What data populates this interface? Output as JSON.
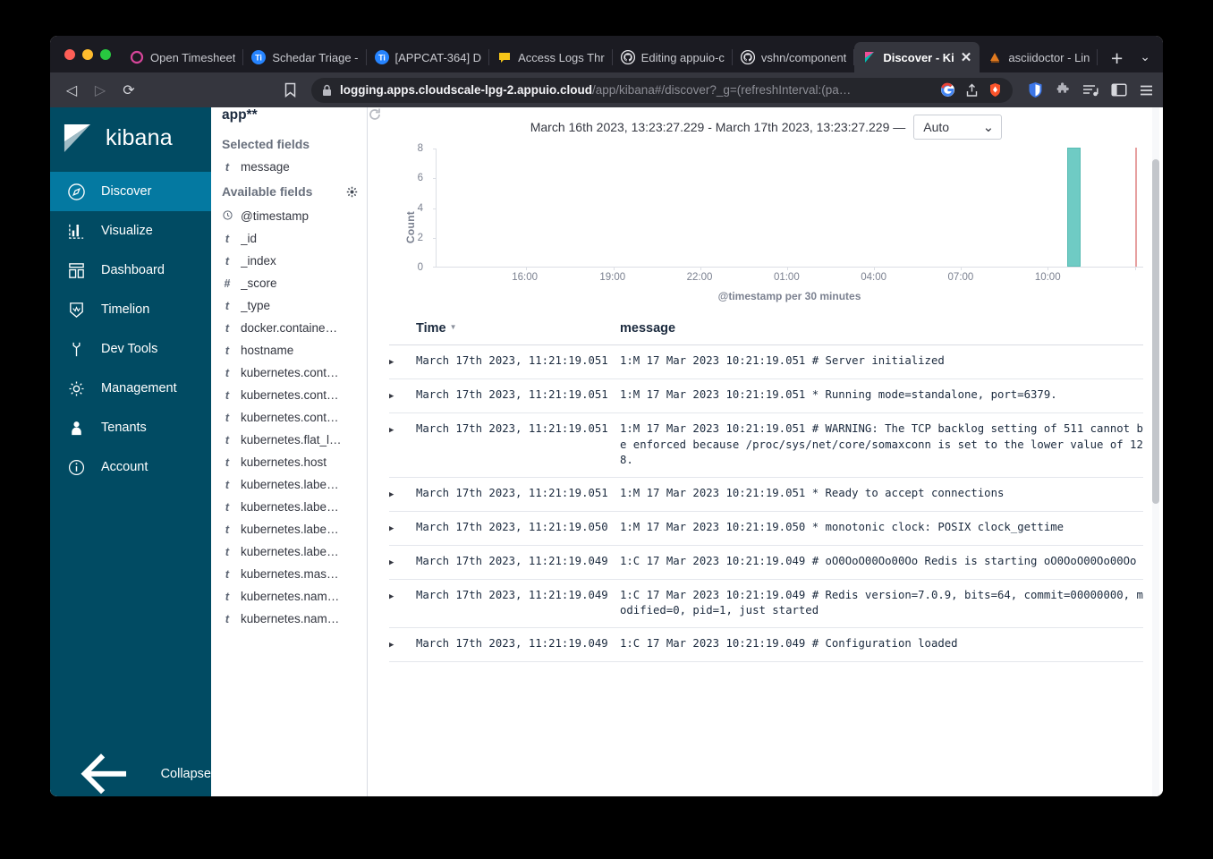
{
  "browser": {
    "tabs": [
      {
        "title": "Open Timesheet",
        "icon": "circle-pink-icon",
        "active": false
      },
      {
        "title": "Schedar Triage -",
        "icon": "jira-icon",
        "active": false
      },
      {
        "title": "[APPCAT-364] D",
        "icon": "jira-icon",
        "active": false
      },
      {
        "title": "Access Logs Thr",
        "icon": "comment-yellow-icon",
        "active": false
      },
      {
        "title": "Editing appuio-c",
        "icon": "github-icon",
        "active": false
      },
      {
        "title": "vshn/component",
        "icon": "github-icon",
        "active": false
      },
      {
        "title": "Discover - Ki",
        "icon": "kibana-icon",
        "active": true
      },
      {
        "title": "asciidoctor - Lin",
        "icon": "asciidoctor-icon",
        "active": false
      }
    ],
    "new_tab_label": "+",
    "tab_list_label": "⌄",
    "url_bold": "logging.apps.cloudscale-lpg-2.appuio.cloud",
    "url_rest": "/app/kibana#/discover?_g=(refreshInterval:(pa…",
    "nav": {
      "back": "◁",
      "forward": "▷",
      "reload": "⟳",
      "bookmark": "bookmark-icon"
    },
    "extensions": [
      "brave-shield-icon",
      "puzzle-extension-icon",
      "playlist-icon",
      "sidebar-icon",
      "hamburger-menu-icon"
    ]
  },
  "kibana": {
    "brand": "kibana",
    "nav_items": [
      {
        "label": "Discover",
        "icon": "compass-icon",
        "active": true
      },
      {
        "label": "Visualize",
        "icon": "bar-chart-icon",
        "active": false
      },
      {
        "label": "Dashboard",
        "icon": "dashboard-icon",
        "active": false
      },
      {
        "label": "Timelion",
        "icon": "timelion-icon",
        "active": false
      },
      {
        "label": "Dev Tools",
        "icon": "wrench-icon",
        "active": false
      },
      {
        "label": "Management",
        "icon": "gear-icon",
        "active": false
      },
      {
        "label": "Tenants",
        "icon": "user-icon",
        "active": false
      },
      {
        "label": "Account",
        "icon": "info-icon",
        "active": false
      }
    ],
    "collapse_label": "Collapse",
    "collapse_icon": "arrow-left-icon"
  },
  "fields_panel": {
    "index_pattern": "app**",
    "selected_fields_label": "Selected fields",
    "selected_fields": [
      {
        "type": "t",
        "name": "message"
      }
    ],
    "available_fields_label": "Available fields",
    "settings_icon": "gear-icon",
    "available_fields": [
      {
        "type": "clock",
        "name": "@timestamp"
      },
      {
        "type": "t",
        "name": "_id"
      },
      {
        "type": "t",
        "name": "_index"
      },
      {
        "type": "#",
        "name": "_score"
      },
      {
        "type": "t",
        "name": "_type"
      },
      {
        "type": "t",
        "name": "docker.containe…"
      },
      {
        "type": "t",
        "name": "hostname"
      },
      {
        "type": "t",
        "name": "kubernetes.cont…"
      },
      {
        "type": "t",
        "name": "kubernetes.cont…"
      },
      {
        "type": "t",
        "name": "kubernetes.cont…"
      },
      {
        "type": "t",
        "name": "kubernetes.flat_l…"
      },
      {
        "type": "t",
        "name": "kubernetes.host"
      },
      {
        "type": "t",
        "name": "kubernetes.labe…"
      },
      {
        "type": "t",
        "name": "kubernetes.labe…"
      },
      {
        "type": "t",
        "name": "kubernetes.labe…"
      },
      {
        "type": "t",
        "name": "kubernetes.labe…"
      },
      {
        "type": "t",
        "name": "kubernetes.mas…"
      },
      {
        "type": "t",
        "name": "kubernetes.nam…"
      },
      {
        "type": "t",
        "name": "kubernetes.nam…"
      }
    ]
  },
  "discover": {
    "time_range": "March 16th 2023, 13:23:27.229 - March 17th 2023, 13:23:27.229 —",
    "interval_value": "Auto",
    "interval_caret": "⌄",
    "columns": {
      "time": "Time",
      "message": "message",
      "sort_caret": "▼"
    },
    "rows": [
      {
        "time": "March 17th 2023, 11:21:19.051",
        "message": "1:M 17 Mar 2023 10:21:19.051 # Server initialized"
      },
      {
        "time": "March 17th 2023, 11:21:19.051",
        "message": "1:M 17 Mar 2023 10:21:19.051 * Running mode=standalone, port=6379."
      },
      {
        "time": "March 17th 2023, 11:21:19.051",
        "message": "1:M 17 Mar 2023 10:21:19.051 # WARNING: The TCP backlog setting of 511 cannot be enforced because /proc/sys/net/core/somaxconn is set to the lower value of 128."
      },
      {
        "time": "March 17th 2023, 11:21:19.051",
        "message": "1:M 17 Mar 2023 10:21:19.051 * Ready to accept connections"
      },
      {
        "time": "March 17th 2023, 11:21:19.050",
        "message": "1:M 17 Mar 2023 10:21:19.050 * monotonic clock: POSIX clock_gettime"
      },
      {
        "time": "March 17th 2023, 11:21:19.049",
        "message": "1:C 17 Mar 2023 10:21:19.049 # oO0OoO00Oo00Oo Redis is starting oO0OoO00Oo00Oo"
      },
      {
        "time": "March 17th 2023, 11:21:19.049",
        "message": "1:C 17 Mar 2023 10:21:19.049 # Redis version=7.0.9, bits=64, commit=00000000, modified=0, pid=1, just started"
      },
      {
        "time": "March 17th 2023, 11:21:19.049",
        "message": "1:C 17 Mar 2023 10:21:19.049 # Configuration loaded"
      }
    ],
    "expand_caret": "▶"
  },
  "chart_data": {
    "type": "bar",
    "title": "",
    "xlabel": "@timestamp per 30 minutes",
    "ylabel": "Count",
    "ylim": [
      0,
      8
    ],
    "yticks": [
      0,
      2,
      4,
      6,
      8
    ],
    "xticks": [
      "16:00",
      "19:00",
      "22:00",
      "01:00",
      "04:00",
      "07:00",
      "10:00"
    ],
    "grid": false,
    "legend": "none",
    "bar_color": "#6fcbc4",
    "marker_color": "#e7a1a1",
    "categories": [
      "11:00"
    ],
    "values": [
      8
    ],
    "annotations": [
      {
        "label": "time-marker",
        "x": "13:23",
        "color": "#e7a1a1"
      }
    ]
  }
}
